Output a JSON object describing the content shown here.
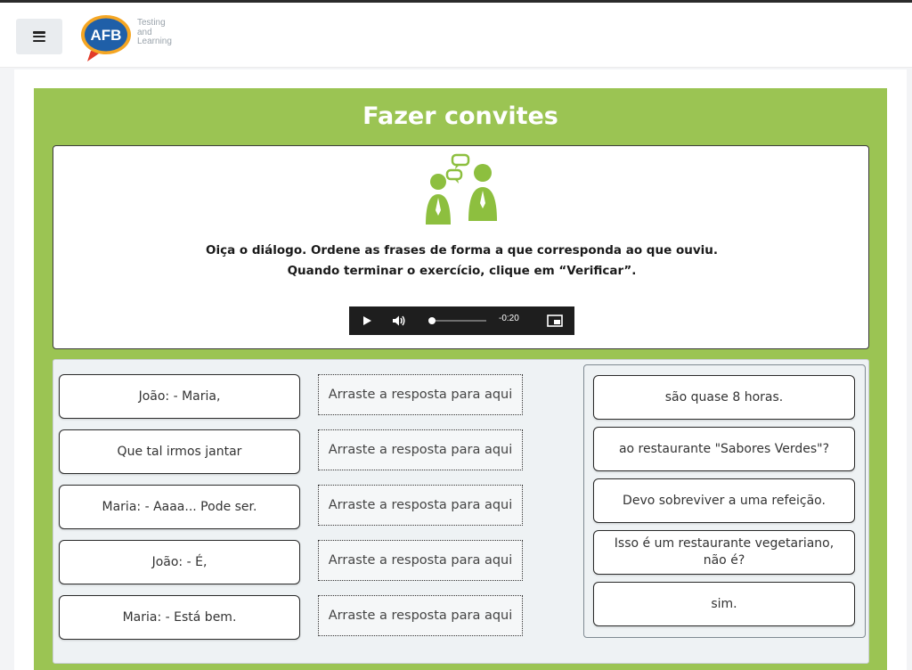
{
  "header": {
    "logo_letters": "AFB",
    "logo_tagline": [
      "Testing",
      "and",
      "Learning"
    ],
    "icons": {
      "menu": "hamburger-menu-icon"
    }
  },
  "activity": {
    "title": "Fazer convites",
    "instruction_line1": "Oiça o diálogo. Ordene as frases de forma a que corresponda ao que ouviu.",
    "instruction_line2": "Quando terminar o exercício, clique em “Verificar”.",
    "colors": {
      "panel": "#9bc453",
      "icon": "#8dbf3f"
    }
  },
  "audio": {
    "time_remaining": "-0:20",
    "progress": 0.0,
    "icons": {
      "play": "play-icon",
      "volume": "volume-icon",
      "pip": "picture-in-picture-icon"
    }
  },
  "phrases": [
    "João: - Maria,",
    "Que tal irmos jantar",
    "Maria: - Aaaa... Pode ser.",
    "João: - É,",
    "Maria: - Está bem."
  ],
  "drop_zone_label": "Arraste a resposta para aqui",
  "answers": [
    "são quase 8 horas.",
    "ao restaurante \"Sabores Verdes\"?",
    "Devo sobreviver a uma refeição.",
    "Isso é um restaurante vegetariano, não é?",
    "sim."
  ]
}
